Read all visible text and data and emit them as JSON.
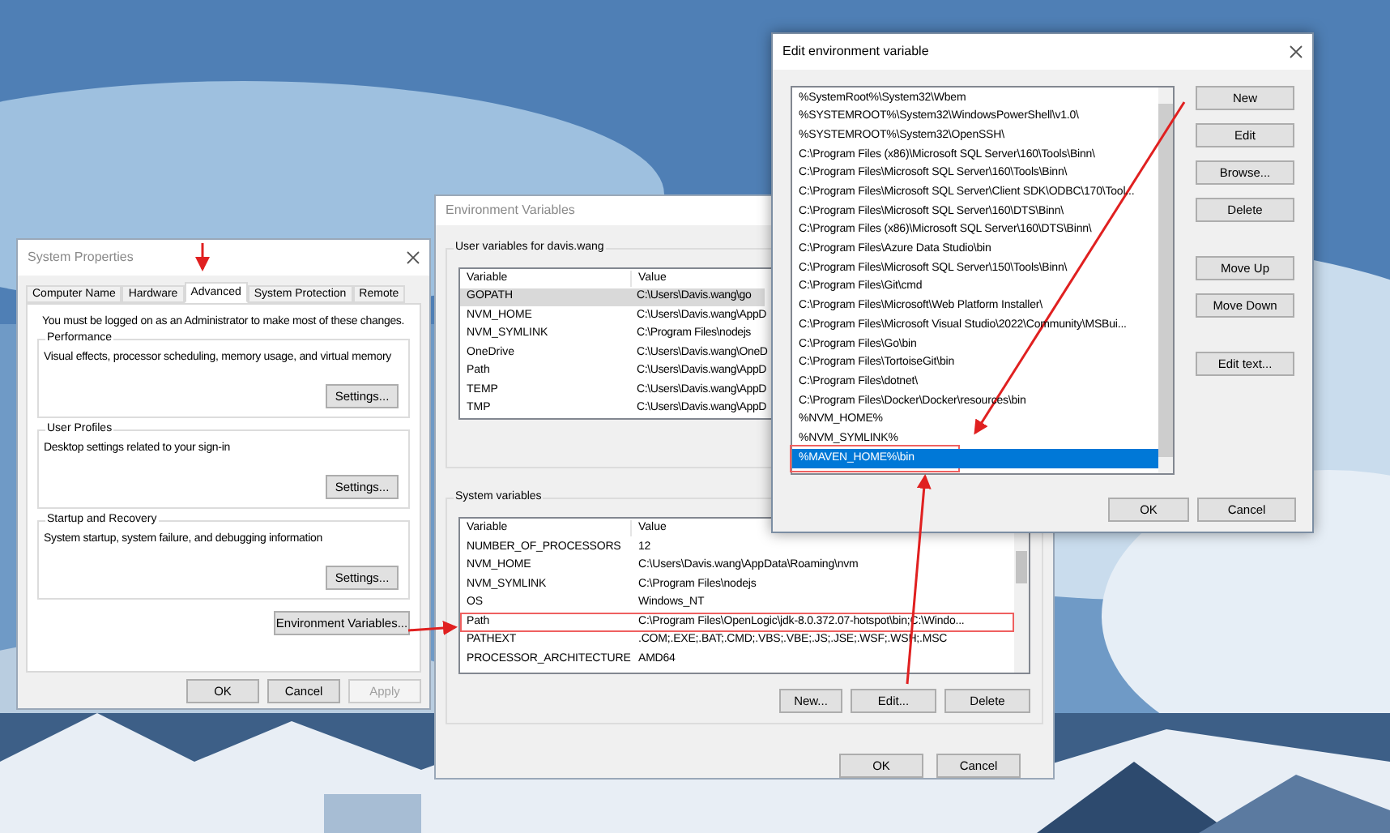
{
  "system_properties": {
    "title": "System Properties",
    "tabs": [
      {
        "label": "Computer Name",
        "selected": false
      },
      {
        "label": "Hardware",
        "selected": false
      },
      {
        "label": "Advanced",
        "selected": true
      },
      {
        "label": "System Protection",
        "selected": false
      },
      {
        "label": "Remote",
        "selected": false
      }
    ],
    "notice": "You must be logged on as an Administrator to make most of these changes.",
    "groups": [
      {
        "title": "Performance",
        "description": "Visual effects, processor scheduling, memory usage, and virtual memory",
        "button": "Settings..."
      },
      {
        "title": "User Profiles",
        "description": "Desktop settings related to your sign-in",
        "button": "Settings..."
      },
      {
        "title": "Startup and Recovery",
        "description": "System startup, system failure, and debugging information",
        "button": "Settings..."
      }
    ],
    "env_button": "Environment Variables...",
    "buttons": [
      {
        "label": "OK",
        "disabled": false
      },
      {
        "label": "Cancel",
        "disabled": false
      },
      {
        "label": "Apply",
        "disabled": true
      }
    ]
  },
  "environment_variables": {
    "title": "Environment Variables",
    "user_group": "User variables for davis.wang",
    "user_columns": [
      "Variable",
      "Value"
    ],
    "user_rows": [
      {
        "variable": "GOPATH",
        "value": "C:\\Users\\Davis.wang\\go",
        "selected": true
      },
      {
        "variable": "NVM_HOME",
        "value": "C:\\Users\\Davis.wang\\AppD",
        "selected": false
      },
      {
        "variable": "NVM_SYMLINK",
        "value": "C:\\Program Files\\nodejs",
        "selected": false
      },
      {
        "variable": "OneDrive",
        "value": "C:\\Users\\Davis.wang\\OneD",
        "selected": false
      },
      {
        "variable": "Path",
        "value": "C:\\Users\\Davis.wang\\AppD",
        "selected": false
      },
      {
        "variable": "TEMP",
        "value": "C:\\Users\\Davis.wang\\AppD",
        "selected": false
      },
      {
        "variable": "TMP",
        "value": "C:\\Users\\Davis.wang\\AppD",
        "selected": false
      }
    ],
    "system_group": "System variables",
    "system_columns": [
      "Variable",
      "Value"
    ],
    "system_rows": [
      {
        "variable": "NUMBER_OF_PROCESSORS",
        "value": "12",
        "outlined": false
      },
      {
        "variable": "NVM_HOME",
        "value": "C:\\Users\\Davis.wang\\AppData\\Roaming\\nvm",
        "outlined": false
      },
      {
        "variable": "NVM_SYMLINK",
        "value": "C:\\Program Files\\nodejs",
        "outlined": false
      },
      {
        "variable": "OS",
        "value": "Windows_NT",
        "outlined": false
      },
      {
        "variable": "Path",
        "value": "C:\\Program Files\\OpenLogic\\jdk-8.0.372.07-hotspot\\bin;C:\\Windo...",
        "outlined": true
      },
      {
        "variable": "PATHEXT",
        "value": ".COM;.EXE;.BAT;.CMD;.VBS;.VBE;.JS;.JSE;.WSF;.WSH;.MSC",
        "outlined": false
      },
      {
        "variable": "PROCESSOR_ARCHITECTURE",
        "value": "AMD64",
        "outlined": false
      }
    ],
    "system_buttons": [
      "New...",
      "Edit...",
      "Delete"
    ],
    "buttons": [
      "OK",
      "Cancel"
    ]
  },
  "edit_variable": {
    "title": "Edit environment variable",
    "entries": [
      {
        "text": "%SystemRoot%\\System32\\Wbem",
        "selected": false
      },
      {
        "text": "%SYSTEMROOT%\\System32\\WindowsPowerShell\\v1.0\\",
        "selected": false
      },
      {
        "text": "%SYSTEMROOT%\\System32\\OpenSSH\\",
        "selected": false
      },
      {
        "text": "C:\\Program Files (x86)\\Microsoft SQL Server\\160\\Tools\\Binn\\",
        "selected": false
      },
      {
        "text": "C:\\Program Files\\Microsoft SQL Server\\160\\Tools\\Binn\\",
        "selected": false
      },
      {
        "text": "C:\\Program Files\\Microsoft SQL Server\\Client SDK\\ODBC\\170\\Tool...",
        "selected": false
      },
      {
        "text": "C:\\Program Files\\Microsoft SQL Server\\160\\DTS\\Binn\\",
        "selected": false
      },
      {
        "text": "C:\\Program Files (x86)\\Microsoft SQL Server\\160\\DTS\\Binn\\",
        "selected": false
      },
      {
        "text": "C:\\Program Files\\Azure Data Studio\\bin",
        "selected": false
      },
      {
        "text": "C:\\Program Files\\Microsoft SQL Server\\150\\Tools\\Binn\\",
        "selected": false
      },
      {
        "text": "C:\\Program Files\\Git\\cmd",
        "selected": false
      },
      {
        "text": "C:\\Program Files\\Microsoft\\Web Platform Installer\\",
        "selected": false
      },
      {
        "text": "C:\\Program Files\\Microsoft Visual Studio\\2022\\Community\\MSBui...",
        "selected": false
      },
      {
        "text": "C:\\Program Files\\Go\\bin",
        "selected": false
      },
      {
        "text": "C:\\Program Files\\TortoiseGit\\bin",
        "selected": false
      },
      {
        "text": "C:\\Program Files\\dotnet\\",
        "selected": false
      },
      {
        "text": "C:\\Program Files\\Docker\\Docker\\resources\\bin",
        "selected": false
      },
      {
        "text": "%NVM_HOME%",
        "selected": false
      },
      {
        "text": "%NVM_SYMLINK%",
        "selected": false
      },
      {
        "text": "%MAVEN_HOME%\\bin",
        "selected": true
      }
    ],
    "side_button_groups": [
      [
        "New",
        "Edit",
        "Browse...",
        "Delete"
      ],
      [
        "Move Up",
        "Move Down"
      ],
      [
        "Edit text..."
      ]
    ],
    "buttons": [
      "OK",
      "Cancel"
    ]
  }
}
